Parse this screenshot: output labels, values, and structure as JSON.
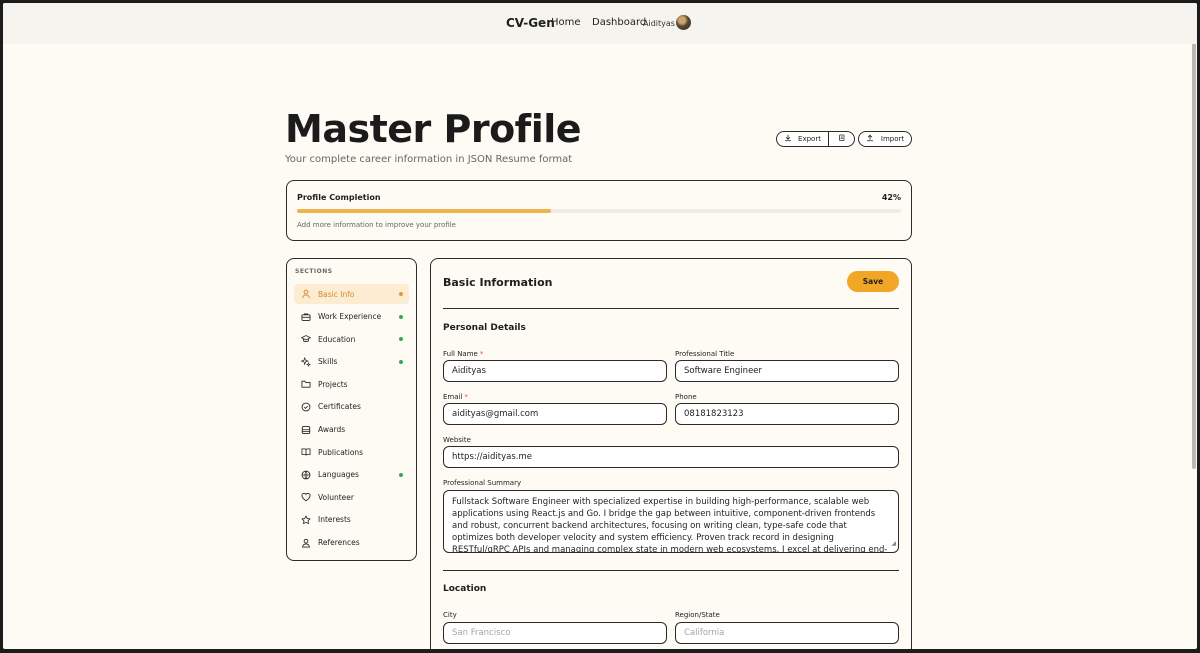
{
  "nav": {
    "brand": "CV-Gen",
    "home": "Home",
    "dashboard": "Dashboard",
    "user": "Aidityas"
  },
  "header": {
    "title": "Master Profile",
    "subtitle": "Your complete career information in JSON Resume format",
    "export_label": "Export",
    "import_label": "Import"
  },
  "completion": {
    "label": "Profile Completion",
    "percent_text": "42%",
    "percent": 42,
    "hint": "Add more information to improve your profile"
  },
  "sidebar": {
    "title": "SECTIONS",
    "items": [
      {
        "label": "Basic Info",
        "icon": "user-icon",
        "active": true,
        "dot": true
      },
      {
        "label": "Work Experience",
        "icon": "briefcase-icon",
        "active": false,
        "dot": true
      },
      {
        "label": "Education",
        "icon": "graduation-cap-icon",
        "active": false,
        "dot": true
      },
      {
        "label": "Skills",
        "icon": "sparkles-icon",
        "active": false,
        "dot": true
      },
      {
        "label": "Projects",
        "icon": "folder-icon",
        "active": false,
        "dot": false
      },
      {
        "label": "Certificates",
        "icon": "badge-check-icon",
        "active": false,
        "dot": false
      },
      {
        "label": "Awards",
        "icon": "award-icon",
        "active": false,
        "dot": false
      },
      {
        "label": "Publications",
        "icon": "book-open-icon",
        "active": false,
        "dot": false
      },
      {
        "label": "Languages",
        "icon": "globe-icon",
        "active": false,
        "dot": true
      },
      {
        "label": "Volunteer",
        "icon": "heart-icon",
        "active": false,
        "dot": false
      },
      {
        "label": "Interests",
        "icon": "star-icon",
        "active": false,
        "dot": false
      },
      {
        "label": "References",
        "icon": "user-check-icon",
        "active": false,
        "dot": false
      }
    ]
  },
  "form": {
    "heading": "Basic Information",
    "save_label": "Save",
    "personal_title": "Personal Details",
    "full_name_label": "Full Name",
    "full_name_value": "Aidityas",
    "title_label": "Professional Title",
    "title_value": "Software Engineer",
    "email_label": "Email",
    "email_value": "aidityas@gmail.com",
    "phone_label": "Phone",
    "phone_value": "08181823123",
    "website_label": "Website",
    "website_value": "https://aidityas.me",
    "summary_label": "Professional Summary",
    "summary_value": "Fullstack Software Engineer with specialized expertise in building high-performance, scalable web applications using React.js and Go. I bridge the gap between intuitive, component-driven frontends and robust, concurrent backend architectures, focusing on writing clean, type-safe code that optimizes both developer velocity and system efficiency. Proven track record in designing RESTful/gRPC APIs and managing complex state in modern web ecosystems. I excel at delivering end-to-end solutions that are as performant under heavy loads as they are",
    "location_title": "Location",
    "city_label": "City",
    "city_placeholder": "San Francisco",
    "region_label": "Region/State",
    "region_placeholder": "California",
    "required_mark": "*"
  },
  "colors": {
    "accent": "#f1a626",
    "progress": "#f0b24a",
    "active_bg": "#fcecd2",
    "dot_green": "#34a853",
    "page_bg": "#fdfbf4"
  }
}
